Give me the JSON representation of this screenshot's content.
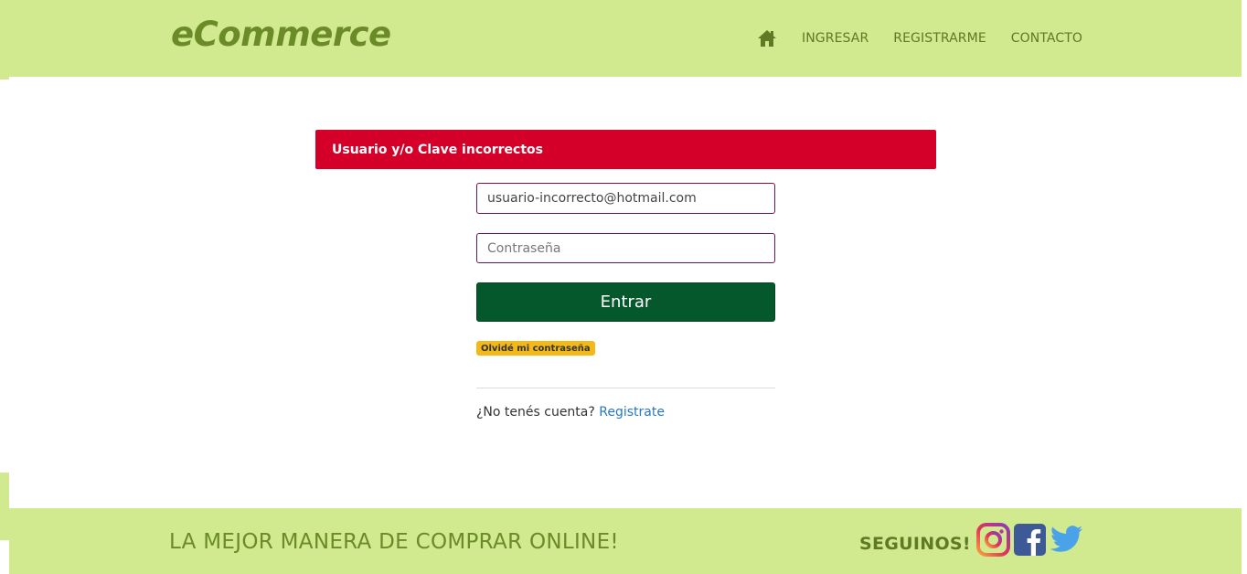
{
  "header": {
    "brand": "eCommerce",
    "nav": {
      "home_icon": "home-icon",
      "items": [
        "INGRESAR",
        "REGISTRARME",
        "CONTACTO"
      ]
    }
  },
  "alert": {
    "message": "Usuario y/o Clave incorrectos",
    "color": "#d50029"
  },
  "login": {
    "email_value": "usuario-incorrecto@hotmail.com",
    "password_placeholder": "Contraseña",
    "submit_label": "Entrar",
    "forgot_label": "Olvidé mi contraseña",
    "no_account_text": "¿No tenés cuenta?",
    "register_link": "Registrate"
  },
  "footer": {
    "tagline": "LA MEJOR MANERA DE COMPRAR ONLINE!",
    "follow_label": "SEGUINOS!",
    "social_icons": [
      "instagram-icon",
      "facebook-icon",
      "twitter-icon"
    ]
  },
  "colors": {
    "header_bg": "#d1e98f",
    "brand_text": "#6b8a28",
    "submit_bg": "#04582c",
    "forgot_badge": "#f4b919",
    "link": "#2777c8"
  }
}
